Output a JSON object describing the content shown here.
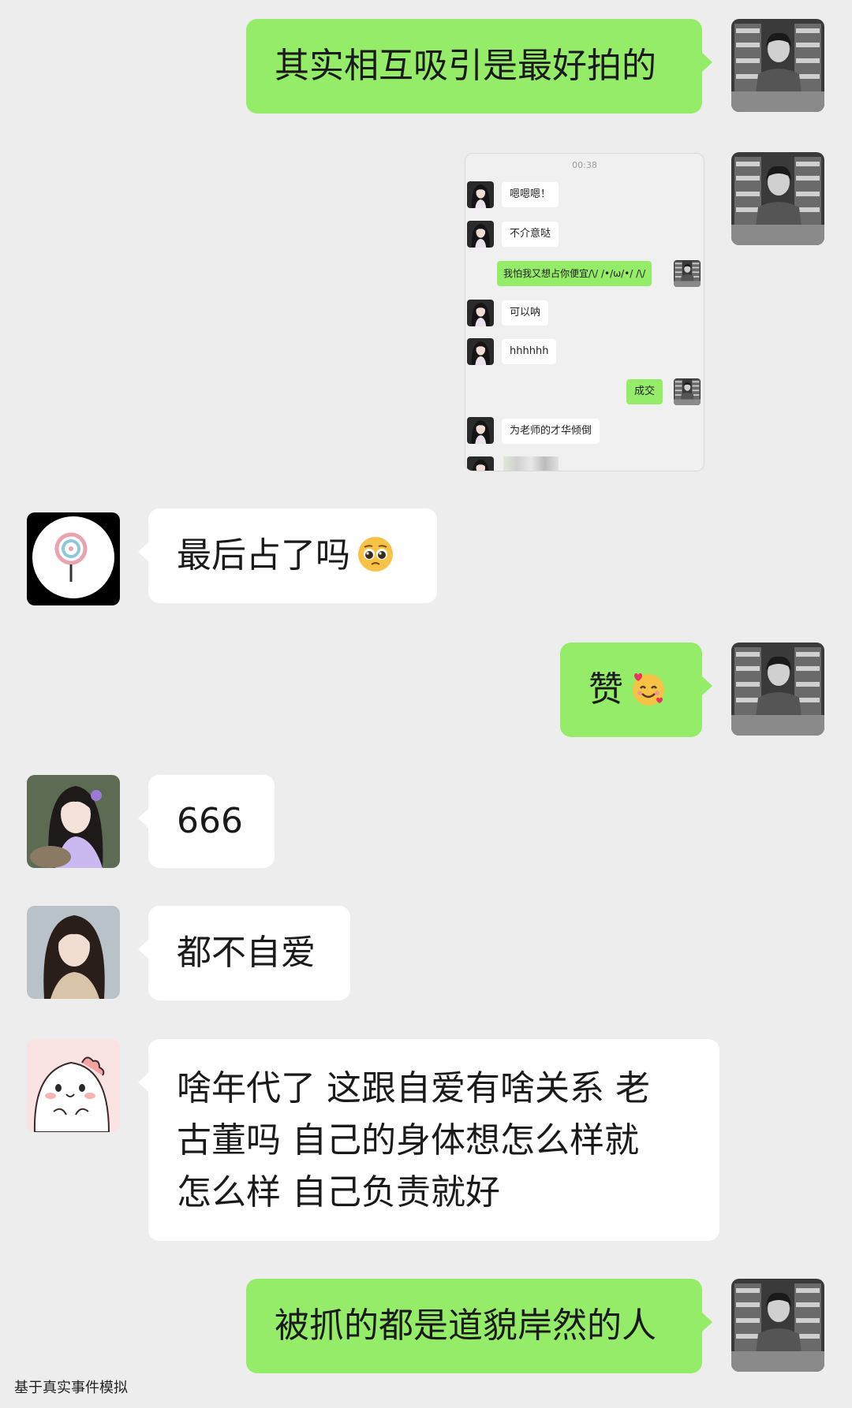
{
  "messages": [
    {
      "id": "m1",
      "text": "其实相互吸引是最好拍的"
    },
    {
      "id": "m3",
      "text": "最后占了吗"
    },
    {
      "id": "m4",
      "text": "赞"
    },
    {
      "id": "m5",
      "text": "666"
    },
    {
      "id": "m6",
      "text": "都不自爱"
    },
    {
      "id": "m7",
      "lines": [
        "啥年代了 这跟自爱有啥关系 老",
        "古董吗 自己的身体想怎么样就",
        "怎么样 自己负责就好"
      ]
    },
    {
      "id": "m8",
      "text": "被抓的都是道貌岸然的人"
    }
  ],
  "embedded_screenshot": {
    "time": "00:38",
    "messages": [
      {
        "side": "them",
        "text": "嗯嗯嗯！"
      },
      {
        "side": "them",
        "text": "不介意哒"
      },
      {
        "side": "me",
        "text": "我怕我又想占你便宜/\\/ /•/ω/•/ /\\/"
      },
      {
        "side": "them",
        "text": "可以呐"
      },
      {
        "side": "them",
        "text": "hhhhhh"
      },
      {
        "side": "me",
        "text": "成交"
      },
      {
        "side": "them",
        "text": "为老师的才华倾倒"
      }
    ]
  },
  "icons": {
    "pleading_face": "pleading-face-emoji",
    "hearts_face": "smiling-face-with-hearts-emoji"
  },
  "colors": {
    "my_bubble": "#95ec69",
    "their_bubble": "#ffffff",
    "background": "#ededed"
  },
  "caption": "基于真实事件模拟"
}
